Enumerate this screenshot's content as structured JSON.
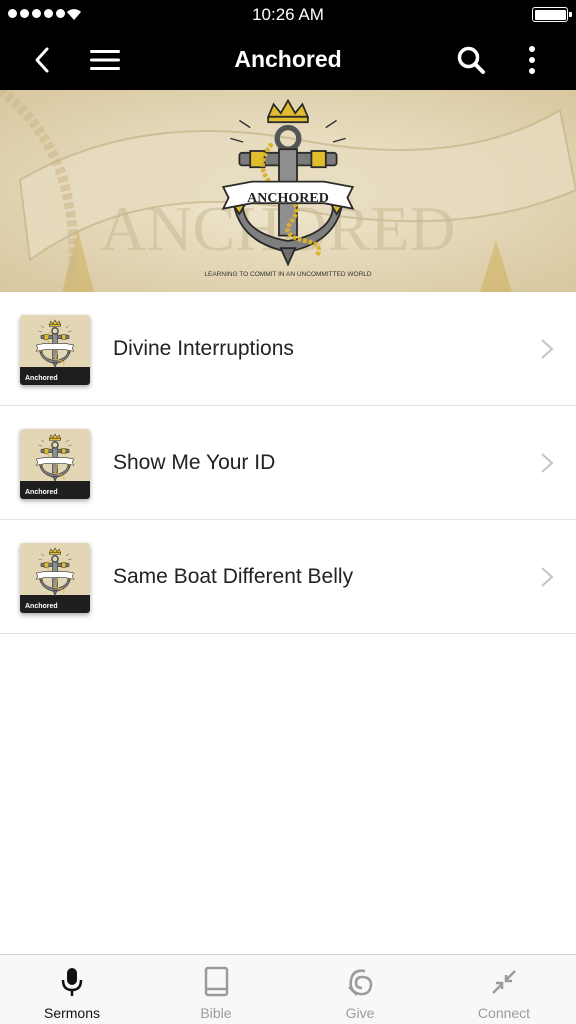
{
  "status_bar": {
    "time": "10:26 AM"
  },
  "nav": {
    "title": "Anchored",
    "icons": [
      "back-icon",
      "hamburger-menu-icon",
      "search-icon",
      "more-vertical-icon"
    ]
  },
  "banner": {
    "badge_title": "ANCHORED",
    "background_text": "ANCHORED",
    "tagline": "LEARNING TO COMMIT IN AN UNCOMMITTED WORLD"
  },
  "sermons": [
    {
      "title": "Divine Interruptions",
      "thumb_label": "Anchored"
    },
    {
      "title": "Show Me Your ID",
      "thumb_label": "Anchored"
    },
    {
      "title": "Same Boat Different Belly",
      "thumb_label": "Anchored"
    }
  ],
  "tabs": [
    {
      "label": "Sermons",
      "icon": "microphone-icon",
      "active": true
    },
    {
      "label": "Bible",
      "icon": "book-icon",
      "active": false
    },
    {
      "label": "Give",
      "icon": "give-icon",
      "active": false
    },
    {
      "label": "Connect",
      "icon": "connect-icon",
      "active": false
    }
  ],
  "colors": {
    "bar_background": "#000000",
    "tab_active": "#111111",
    "tab_inactive": "#9b9b9b",
    "banner_gold": "#d4b23a",
    "banner_parchment": "#e8dcc0"
  }
}
